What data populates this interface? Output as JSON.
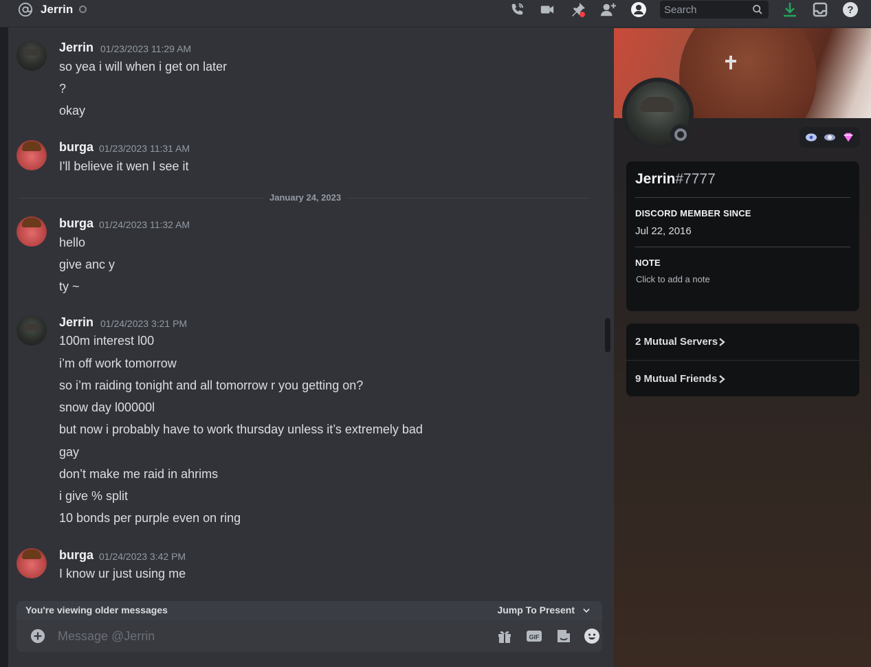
{
  "header": {
    "title": "Jerrin",
    "search_placeholder": "Search"
  },
  "messages": [
    {
      "author": "Jerrin",
      "timestamp": "01/23/2023 11:29 AM",
      "avatar": "jerrin-avatar",
      "lines": [
        "so yea i will when i get on later",
        "?",
        "okay"
      ]
    },
    {
      "author": "burga",
      "timestamp": "01/23/2023 11:31 AM",
      "avatar": "burga-avatar",
      "lines": [
        "I'll believe it wen I see it"
      ]
    },
    {
      "author": "burga",
      "timestamp": "01/24/2023 11:32 AM",
      "avatar": "burga-avatar",
      "lines": [
        "hello",
        "give anc y",
        "ty ~"
      ]
    },
    {
      "author": "Jerrin",
      "timestamp": "01/24/2023 3:21 PM",
      "avatar": "jerrin-avatar",
      "lines": [
        "100m interest l00",
        "i’m off work tomorrow",
        "so i’m raiding tonight and all tomorrow r you getting on?",
        "snow day l00000l",
        "but now i probably have to work thursday unless it’s extremely bad",
        "gay",
        "don’t make me raid in ahrims",
        "i give % split",
        "10 bonds per purple even on ring"
      ]
    },
    {
      "author": "burga",
      "timestamp": "01/24/2023 3:42 PM",
      "avatar": "burga-avatar",
      "lines": [
        "I know ur just using me"
      ]
    }
  ],
  "date_divider": "January 24, 2023",
  "older_messages_bar": {
    "text": "You're viewing older messages",
    "jump_label": "Jump To Present"
  },
  "composer": {
    "placeholder": "Message @Jerrin"
  },
  "profile": {
    "username": "Jerrin",
    "discriminator": "#7777",
    "member_since_label": "DISCORD MEMBER SINCE",
    "member_since": "Jul 22, 2016",
    "note_label": "NOTE",
    "note_placeholder": "Click to add a note",
    "mutual_servers": "2 Mutual Servers",
    "mutual_friends": "9 Mutual Friends"
  },
  "colors": {
    "background": "#313338",
    "download_accent": "#23a55a",
    "pin_badge": "#f23f43"
  },
  "icons": [
    "at-icon",
    "call-icon",
    "video-icon",
    "pin-icon",
    "add-friend-icon",
    "profile-toggle-icon",
    "search-icon",
    "download-icon",
    "inbox-icon",
    "help-icon",
    "plus-icon",
    "gift-icon",
    "gif-icon",
    "sticker-icon",
    "emoji-icon"
  ]
}
